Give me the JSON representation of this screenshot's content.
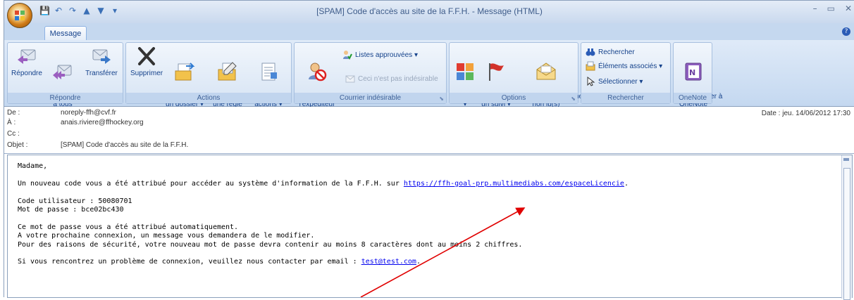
{
  "window": {
    "title": "[SPAM] Code d'accès au site de la F.F.H. - Message (HTML)",
    "controls": [
      "–",
      "▭",
      "✕"
    ]
  },
  "tabs": [
    "Message"
  ],
  "ribbon": {
    "groups": {
      "repondre": {
        "label": "Répondre",
        "buttons": [
          "Répondre",
          "Répondre\nà tous",
          "Transférer"
        ]
      },
      "actions": {
        "label": "Actions",
        "buttons": [
          "Supprimer",
          "Déplacer vers\nun dossier ▾",
          "Créer\nune règle",
          "Autres\nactions ▾"
        ]
      },
      "courrier": {
        "label": "Courrier indésirable",
        "block": "Bloquer\nl'expéditeur",
        "listes": "Listes approuvées ▾",
        "non_indesirable": "Ceci n'est pas indésirable"
      },
      "options": {
        "label": "Options",
        "buttons": [
          "Classer\n▾",
          "Assurer\nun suivi ▾",
          "Marquer comme\nnon lu(s)"
        ]
      },
      "rechercher": {
        "label": "Rechercher",
        "items": [
          "Rechercher",
          "Éléments associés ▾",
          "Sélectionner ▾"
        ]
      },
      "onenote": {
        "label": "OneNote",
        "button": "Envoyer à\nOneNote"
      }
    }
  },
  "header": {
    "from_label": "De :",
    "from": "noreply-ffh@cvf.fr",
    "to_label": "À :",
    "to": "anais.riviere@ffhockey.org",
    "cc_label": "Cc :",
    "cc": "",
    "subject_label": "Objet :",
    "subject": "[SPAM] Code d'accès au site de la F.F.H.",
    "date_label": "Date :",
    "date": "jeu. 14/06/2012 17:30"
  },
  "body": {
    "greeting": "Madame,",
    "line1": "Un nouveau code vous a été attribué pour accéder au système d'information de la F.F.H. sur ",
    "link": "https://ffh-goal-prp.multimediabs.com/espaceLicencie",
    "line1_end": ".",
    "user_code": "Code utilisateur : 50080701",
    "password": "Mot de passe : bce02bc430",
    "p1": "Ce mot de passe vous a été attribué automatiquement.",
    "p2": "A votre prochaine connexion, un message vous demandera de le modifier.",
    "p3": "Pour des raisons de sécurité, votre nouveau mot de passe devra contenir au moins 8 caractères dont au moins 2 chiffres.",
    "contact": "Si vous rencontrez un problème de connexion, veuillez nous contacter par email : ",
    "email": "test@test.com",
    "contact_end": "."
  },
  "colors": {
    "annotation_arrow": "#e00000",
    "ribbon_bg": "#c4d8f0",
    "link": "#0000ee"
  }
}
